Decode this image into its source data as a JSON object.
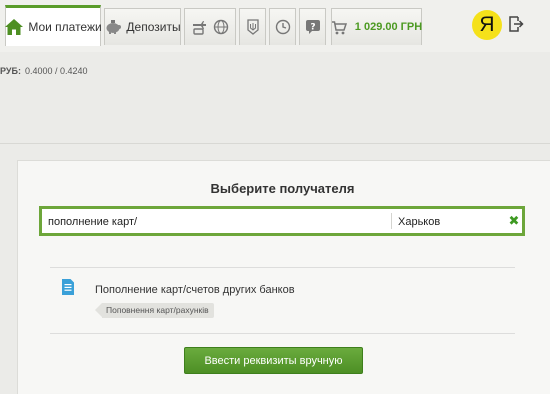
{
  "header": {
    "tabs": [
      {
        "label": "Мои платежи",
        "icon": "home-icon",
        "active": true
      },
      {
        "label": "Депозиты",
        "icon": "piggy-bank-icon"
      },
      {
        "label": "",
        "icon": "transport-icon"
      },
      {
        "label": "",
        "icon": "globe-icon"
      },
      {
        "label": "",
        "icon": "coat-of-arms-icon"
      },
      {
        "label": "",
        "icon": "clock-icon"
      },
      {
        "label": "",
        "icon": "help-icon"
      },
      {
        "label": "",
        "icon": "cart-icon"
      }
    ],
    "balance": "1 029.00 ГРН",
    "user_initial": "Я",
    "logout_icon": "logout-icon"
  },
  "rate": {
    "label": "РУБ:",
    "value": "0.4000 / 0.4240"
  },
  "main": {
    "title": "Выберите получателя",
    "search_value": "пополнение карт/",
    "city_value": "Харьков",
    "clear_symbol": "✖",
    "result": {
      "title": "Пополнение карт/счетов других банков",
      "tag": "Поповнення карт/рахунків",
      "icon": "document-icon"
    },
    "manual_button": "Ввести реквизиты вручную"
  },
  "colors": {
    "accent": "#5a9c2a",
    "balance": "#4c9a22",
    "user": "#f5e11a",
    "icon_blue": "#3aa0d8"
  }
}
